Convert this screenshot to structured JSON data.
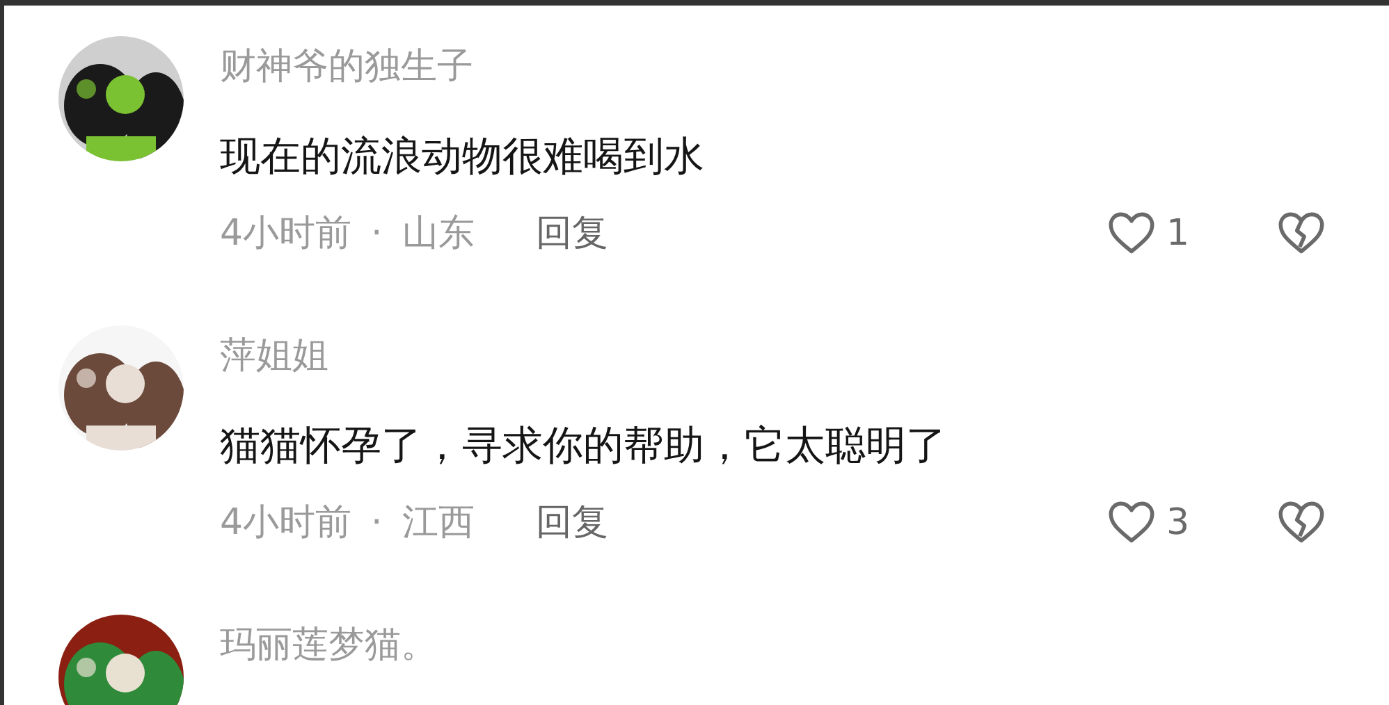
{
  "comments": [
    {
      "username": "财神爷的独生子",
      "text": "现在的流浪动物很难喝到水",
      "time": "4小时前",
      "separator": "·",
      "location": "山东",
      "reply": "回复",
      "likes": "1"
    },
    {
      "username": "萍姐姐",
      "text": "猫猫怀孕了，寻求你的帮助，它太聪明了",
      "time": "4小时前",
      "separator": "·",
      "location": "江西",
      "reply": "回复",
      "likes": "3"
    },
    {
      "username": "玛丽莲梦猫。"
    }
  ]
}
